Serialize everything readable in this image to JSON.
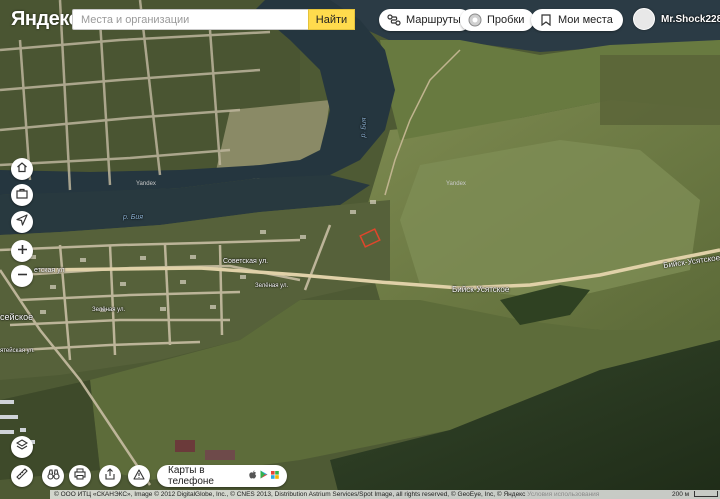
{
  "header": {
    "logo_text": "Яндекс",
    "search_placeholder": "Места и организации",
    "search_button": "Найти",
    "routes_label": "Маршруты",
    "traffic_label": "Пробки",
    "my_places_label": "Мои места",
    "username": "Mr.Shock228"
  },
  "map_labels": {
    "river_top": "р. Бия",
    "river_left": "р. Бия",
    "watermark_1": "Yandex",
    "watermark_2": "Yandex",
    "street_sovetskaya": "Советская ул.",
    "street_sovetskaya_cut": "етская ул",
    "street_zelenaya": "Зелёная ул.",
    "street_zelenaya_2": "Зелёная ул.",
    "road_main": "Бийск-Усятское",
    "road_right": "Бийск-Усятское",
    "village_cut": "сейское",
    "street_cut": "ятейская ул."
  },
  "bottom": {
    "phone_label": "Карты в телефоне",
    "copyright_text": "© ООО ИТЦ «СКАНЭКС», Image © 2012 DigitalGlobe, Inc., © CNES 2013, Distribution Astrium Services/Spot Image, all rights reserved, © GeoEye, Inc, © Яндекс",
    "terms_label": "Условия использования",
    "scale_label": "200 м"
  },
  "icons": {
    "routes": "route-icon",
    "traffic": "traffic-icon",
    "my_places": "bookmark-icon",
    "home": "home-icon",
    "work": "briefcase-icon",
    "locate": "location-arrow-icon",
    "zoom_in": "plus-icon",
    "zoom_out": "minus-icon",
    "layers": "layers-icon",
    "ruler": "ruler-icon",
    "panorama": "binoculars-icon",
    "print": "print-icon",
    "share": "share-icon",
    "report": "warning-icon"
  },
  "colors": {
    "search_button": "#ffdb4d",
    "river": "#25363f",
    "field": "#6e7b48",
    "forest": "#2c3d1f",
    "road": "#d9c9a3",
    "marker": "#e0462b"
  }
}
